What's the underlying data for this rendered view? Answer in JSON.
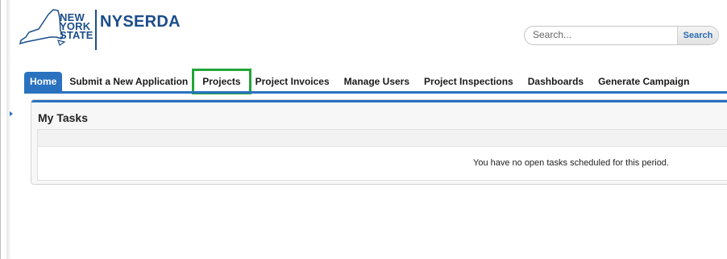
{
  "logo": {
    "state_lines": [
      "NEW",
      "YORK",
      "STATE"
    ],
    "brand": "NYSERDA",
    "brand_color": "#1b4d8a"
  },
  "search": {
    "placeholder": "Search...",
    "button_label": "Search"
  },
  "nav": {
    "tabs": [
      {
        "label": "Home",
        "active": true
      },
      {
        "label": "Submit a New Application"
      },
      {
        "label": "Projects",
        "highlighted": true
      },
      {
        "label": "Project Invoices"
      },
      {
        "label": "Manage Users"
      },
      {
        "label": "Project Inspections"
      },
      {
        "label": "Dashboards"
      },
      {
        "label": "Generate Campaign"
      }
    ],
    "accent_color": "#2a72c0",
    "highlight_color": "#21a637"
  },
  "tasks": {
    "title": "My Tasks",
    "empty_message": "You have no open tasks scheduled for this period."
  }
}
